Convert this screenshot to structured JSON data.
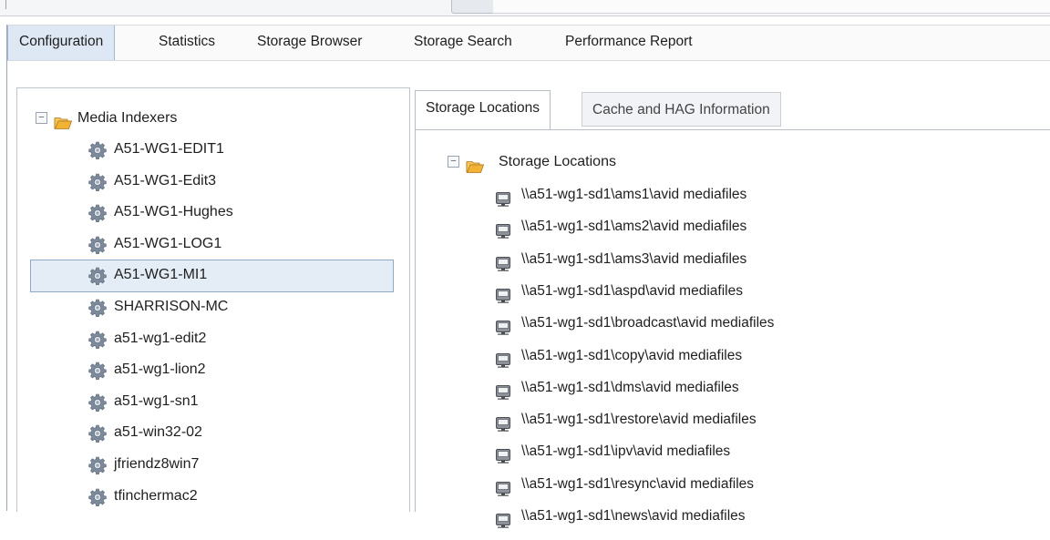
{
  "menubar": {
    "items": [
      {
        "label": "Configuration",
        "active": true
      },
      {
        "label": "Statistics",
        "active": false
      },
      {
        "label": "Storage Browser",
        "active": false
      },
      {
        "label": "Storage Search",
        "active": false
      },
      {
        "label": "Performance Report",
        "active": false
      }
    ]
  },
  "left_tree": {
    "root_label": "Media Indexers",
    "root_expander": "−",
    "selected": "A51-WG1-MI1",
    "items": [
      {
        "label": "A51-WG1-EDIT1"
      },
      {
        "label": "A51-WG1-Edit3"
      },
      {
        "label": "A51-WG1-Hughes"
      },
      {
        "label": "A51-WG1-LOG1"
      },
      {
        "label": "A51-WG1-MI1"
      },
      {
        "label": "SHARRISON-MC"
      },
      {
        "label": "a51-wg1-edit2"
      },
      {
        "label": "a51-wg1-lion2"
      },
      {
        "label": "a51-wg1-sn1"
      },
      {
        "label": "a51-win32-02"
      },
      {
        "label": "jfriendz8win7"
      },
      {
        "label": "tfinchermac2"
      }
    ]
  },
  "tabs": [
    {
      "label": "Storage Locations",
      "active": true
    },
    {
      "label": "Cache and HAG Information",
      "active": false
    }
  ],
  "storage_tree": {
    "root_label": "Storage Locations",
    "root_expander": "−",
    "items": [
      {
        "label": "\\\\a51-wg1-sd1\\ams1\\avid mediafiles"
      },
      {
        "label": "\\\\a51-wg1-sd1\\ams2\\avid mediafiles"
      },
      {
        "label": "\\\\a51-wg1-sd1\\ams3\\avid mediafiles"
      },
      {
        "label": "\\\\a51-wg1-sd1\\aspd\\avid mediafiles"
      },
      {
        "label": "\\\\a51-wg1-sd1\\broadcast\\avid mediafiles"
      },
      {
        "label": "\\\\a51-wg1-sd1\\copy\\avid mediafiles"
      },
      {
        "label": "\\\\a51-wg1-sd1\\dms\\avid mediafiles"
      },
      {
        "label": "\\\\a51-wg1-sd1\\restore\\avid mediafiles"
      },
      {
        "label": "\\\\a51-wg1-sd1\\ipv\\avid mediafiles"
      },
      {
        "label": "\\\\a51-wg1-sd1\\resync\\avid mediafiles"
      },
      {
        "label": "\\\\a51-wg1-sd1\\news\\avid mediafiles"
      }
    ]
  },
  "icons": {
    "expander": "collapse-icon",
    "folder": "folder-open-icon",
    "indexer": "gear-icon",
    "storage": "network-drive-icon"
  },
  "colors": {
    "accent": "#dde8f4",
    "selection": "#e4ecf6",
    "folder": "#f2b233",
    "gear": "#8a97a8"
  }
}
